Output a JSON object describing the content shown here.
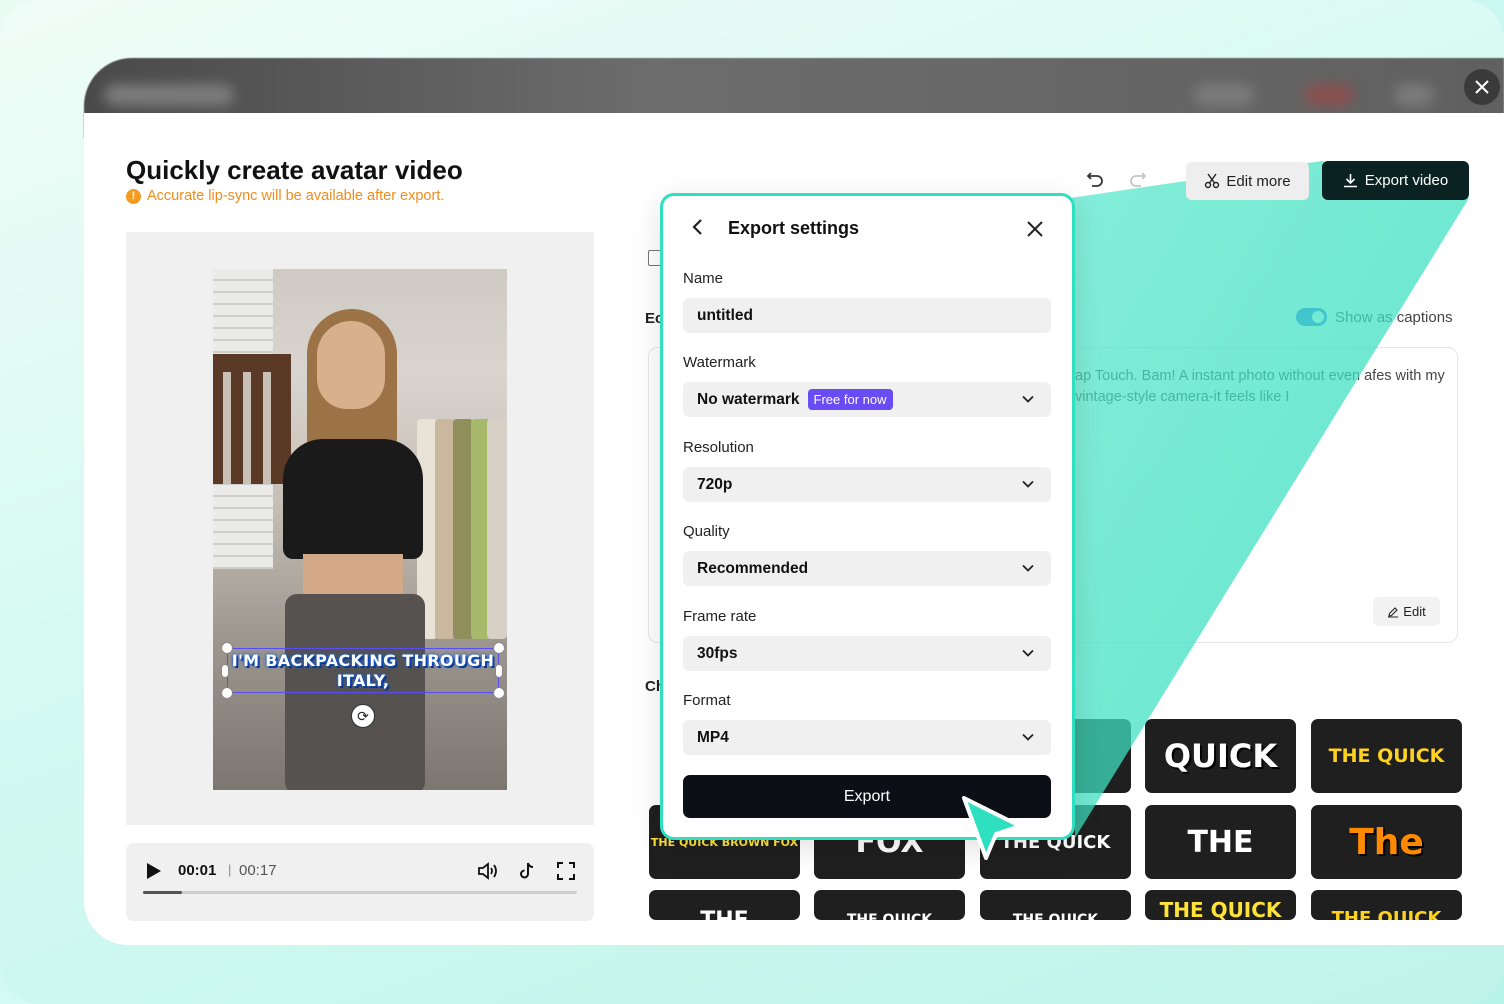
{
  "page": {
    "title": "Quickly create avatar video",
    "warning": "Accurate lip-sync will be available after export.",
    "warning_icon": "!"
  },
  "toolbar": {
    "edit_more_label": "Edit more",
    "export_video_label": "Export video"
  },
  "video": {
    "caption_line1": "I'M BACKPACKING THROUGH",
    "caption_line2": "ITALY,"
  },
  "player": {
    "current_time": "00:01",
    "separator": "|",
    "total_time": "00:17",
    "progress": 0.09
  },
  "script_panel": {
    "section_label_fragment": "Ec",
    "characters_label_fragment": "Ch",
    "show_captions_label": "Show as captions",
    "show_captions_on": true,
    "script_text": "ap Touch. Bam! A instant photo without even afes with my vintage-style camera-it feels like I",
    "edit_label": "Edit"
  },
  "caption_styles": [
    {
      "text": "THE QUICK BROWN FOX",
      "color": "#ffe23a"
    },
    {
      "text": "FOX",
      "color": "#ffffff"
    },
    {
      "text": "k",
      "color": "#ffffff"
    },
    {
      "text": "THE QUICK",
      "color": "#ffffff"
    },
    {
      "text": "QUICK",
      "color": "#ffffff"
    },
    {
      "text": "THE QUICK",
      "color": "#ffd21f"
    },
    {
      "text": "THE",
      "color": "#ffffff"
    },
    {
      "text": "The",
      "color": "#ff8a00"
    },
    {
      "text": "THE",
      "color": "#ffffff"
    },
    {
      "text": "THE QUICK",
      "color": "#ffffff"
    },
    {
      "text": "THE QUICK",
      "color": "#ffffff"
    },
    {
      "text": "THE QUICK",
      "color": "#ffe23a"
    },
    {
      "text": "THE QUICK",
      "color": "#ffd21f"
    }
  ],
  "export_modal": {
    "title": "Export settings",
    "name_label": "Name",
    "name_value": "untitled",
    "watermark_label": "Watermark",
    "watermark_value": "No watermark",
    "watermark_badge": "Free for now",
    "resolution_label": "Resolution",
    "resolution_value": "720p",
    "quality_label": "Quality",
    "quality_value": "Recommended",
    "frame_rate_label": "Frame rate",
    "frame_rate_value": "30fps",
    "format_label": "Format",
    "format_value": "MP4",
    "export_label": "Export"
  },
  "colors": {
    "accent_teal": "#2ee0c0",
    "export_dark": "#0a2222",
    "warning_orange": "#f08c1a",
    "badge_purple": "#6a4cf5"
  }
}
